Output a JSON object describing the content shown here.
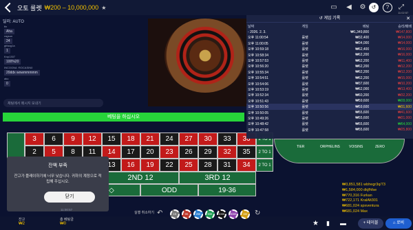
{
  "header": {
    "title": "오토 룰렛",
    "range": "₩200 – 10,000,000",
    "time": "11:02:57"
  },
  "dealer": {
    "label": "딜러: AUTO"
  },
  "chat": {
    "messages": [
      {
        "user": "ttx",
        "text": "Aha"
      },
      {
        "user": "ragsun",
        "text": "24"
      },
      {
        "user": "gtfaog1a",
        "text": "1"
      },
      {
        "user": "Knp1307",
        "text": "100%20"
      },
      {
        "user": "INCOGNA ·ROCASIN0",
        "text": "20ddx wowmmmmm"
      },
      {
        "user": "aku",
        "text": "0"
      }
    ],
    "placeholder": "채팅에서 메시지 보내기"
  },
  "banner": {
    "text": "베팅을 하십시오"
  },
  "board": {
    "rows": [
      [
        {
          "n": "3",
          "c": "red"
        },
        {
          "n": "6",
          "c": "blk"
        },
        {
          "n": "9",
          "c": "red"
        },
        {
          "n": "12",
          "c": "red"
        },
        {
          "n": "15",
          "c": "blk"
        },
        {
          "n": "18",
          "c": "red"
        },
        {
          "n": "21",
          "c": "red"
        },
        {
          "n": "24",
          "c": "blk"
        },
        {
          "n": "27",
          "c": "red"
        },
        {
          "n": "30",
          "c": "red"
        },
        {
          "n": "33",
          "c": "blk"
        },
        {
          "n": "36",
          "c": "red"
        }
      ],
      [
        {
          "n": "2",
          "c": "blk"
        },
        {
          "n": "5",
          "c": "red"
        },
        {
          "n": "8",
          "c": "blk"
        },
        {
          "n": "11",
          "c": "blk"
        },
        {
          "n": "14",
          "c": "red"
        },
        {
          "n": "17",
          "c": "blk"
        },
        {
          "n": "20",
          "c": "blk"
        },
        {
          "n": "23",
          "c": "red"
        },
        {
          "n": "26",
          "c": "blk"
        },
        {
          "n": "29",
          "c": "blk"
        },
        {
          "n": "32",
          "c": "red"
        },
        {
          "n": "35",
          "c": "blk"
        }
      ],
      [
        {
          "n": "1",
          "c": "red"
        },
        {
          "n": "4",
          "c": "blk"
        },
        {
          "n": "7",
          "c": "red"
        },
        {
          "n": "10",
          "c": "blk"
        },
        {
          "n": "13",
          "c": "blk"
        },
        {
          "n": "16",
          "c": "red"
        },
        {
          "n": "19",
          "c": "red"
        },
        {
          "n": "22",
          "c": "blk"
        },
        {
          "n": "25",
          "c": "red"
        },
        {
          "n": "28",
          "c": "blk"
        },
        {
          "n": "31",
          "c": "blk"
        },
        {
          "n": "34",
          "c": "red"
        }
      ]
    ],
    "columns": [
      "2 TO 1",
      "2 TO 1",
      "2 TO 1"
    ],
    "dozens": [
      "",
      "2ND 12",
      "3RD 12"
    ],
    "outside": [
      "",
      "◇",
      "ODD",
      "19-36"
    ]
  },
  "history": {
    "title": "게임 기록",
    "date": "2026. 2. 3.",
    "headers": [
      "날짜",
      "게임",
      "베팅",
      "승리/패배"
    ],
    "total": {
      "bet": "₩1,349,800",
      "result": "₩147,800"
    },
    "rows": [
      {
        "time": "오후 11:00:54",
        "game": "룰렛",
        "bet": "₩32,400",
        "result": "₩14,000",
        "res_c": "neg"
      },
      {
        "time": "오후 11:00:05",
        "game": "룰렛",
        "bet": "₩34,000",
        "result": "₩14,000",
        "res_c": "neg"
      },
      {
        "time": "오후 10:59:18",
        "game": "룰렛",
        "bet": "₩62,400",
        "result": "₩16,000",
        "res_c": "neg"
      },
      {
        "time": "오후 10:58:34",
        "game": "룰렛",
        "bet": "₩62,200",
        "result": "₩16,000",
        "res_c": "neg"
      },
      {
        "time": "오후 10:57:53",
        "game": "룰렛",
        "bet": "₩62,200",
        "result": "₩11,400",
        "res_c": "neg"
      },
      {
        "time": "오후 10:56:20",
        "game": "룰렛",
        "bet": "₩62,200",
        "result": "₩12,200",
        "res_c": "neg"
      },
      {
        "time": "오후 10:55:34",
        "game": "룰렛",
        "bet": "₩62,200",
        "result": "₩12,200",
        "res_c": "neg"
      },
      {
        "time": "오후 10:54:51",
        "game": "룰렛",
        "bet": "₩62,200",
        "result": "₩15,000",
        "res_c": "neg"
      },
      {
        "time": "오후 10:54:06",
        "game": "룰렛",
        "bet": "₩37,600",
        "result": "₩10,200",
        "res_c": "neg"
      },
      {
        "time": "오후 10:53:19",
        "game": "룰렛",
        "bet": "₩62,000",
        "result": "₩13,400",
        "res_c": "neg"
      },
      {
        "time": "오후 10:52:34",
        "game": "룰렛",
        "bet": "₩60,200",
        "result": "₩32,200",
        "res_c": "neg"
      },
      {
        "time": "오후 10:51:43",
        "game": "룰렛",
        "bet": "₩59,600",
        "result": "₩28,000",
        "res_c": "pos"
      },
      {
        "time": "오후 10:50:56",
        "game": "룰렛",
        "bet": "₩59,600",
        "result": "₩31,600",
        "res_c": "y",
        "sel": true
      },
      {
        "time": "오후 10:50:05",
        "game": "룰렛",
        "bet": "₩55,600",
        "result": "₩41,600",
        "res_c": "neg"
      },
      {
        "time": "오후 10:49:26",
        "game": "룰렛",
        "bet": "₩55,600",
        "result": "₩21,000",
        "res_c": "neg"
      },
      {
        "time": "오후 10:48:42",
        "game": "룰렛",
        "bet": "₩55,600",
        "result": "₩64,000",
        "res_c": "pos"
      },
      {
        "time": "오후 10:47:58",
        "game": "룰렛",
        "bet": "₩55,600",
        "result": "₩25,800",
        "res_c": "neg"
      }
    ]
  },
  "wheelnav": {
    "labels": [
      "TIER",
      "ORPHELINS",
      "VOISINS",
      "ZERO"
    ]
  },
  "dialog": {
    "title": "잔액 부족",
    "message": "잔고가 플레이하기에 너무 낮습니다. 귀하의 계정으로 적립해 주십시오.",
    "ok": "닫기",
    "time": "11:00:57"
  },
  "winners": [
    "₩3,851,581 wbhegr3q/73",
    "₩1,584,000 dkjfhfse",
    "₩770,316 Furkan",
    "₩722,171 KralAlt301",
    "₩681,024 spxventura",
    "₩681,024 Max"
  ],
  "bottom": {
    "balance_label": "잔고",
    "balance": "₩2",
    "bet_label": "총 베팅금",
    "bet": "₩0",
    "undo_label": "실행 취소하기",
    "chips": [
      "1K",
      "5K",
      "25K",
      "50K",
      "100K",
      "500K",
      "1M"
    ],
    "table_btn": "테이블",
    "lobby_btn": "로비"
  }
}
